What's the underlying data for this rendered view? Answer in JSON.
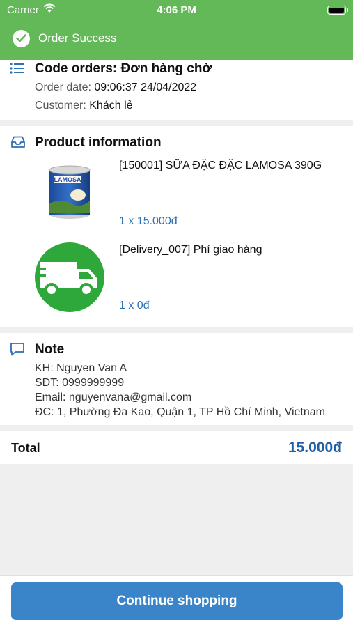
{
  "status_bar": {
    "carrier": "Carrier",
    "time": "4:06 PM"
  },
  "header": {
    "title": "Order Success"
  },
  "order": {
    "code_label": "Code orders: ",
    "code_value": "Đơn hàng chờ",
    "date_label": "Order date: ",
    "date_value": "09:06:37 24/04/2022",
    "customer_label": "Customer: ",
    "customer_value": "Khách lẻ"
  },
  "products": {
    "title": "Product information",
    "items": [
      {
        "name": "[150001] SỮA ĐẶC ĐẶC LAMOSA 390G",
        "qty": "1 x 15.000đ",
        "image": "lamosa-milk-can",
        "label_text": "LAMOSA"
      },
      {
        "name": "[Delivery_007] Phí giao hàng",
        "qty": "1 x 0đ",
        "image": "delivery-truck-icon"
      }
    ]
  },
  "note": {
    "title": "Note",
    "lines": [
      "KH: Nguyen Van A",
      "SĐT: 0999999999",
      "Email: nguyenvana@gmail.com",
      "ĐC: 1, Phường Đa Kao, Quận 1, TP Hồ Chí Minh, Vietnam"
    ]
  },
  "total": {
    "label": "Total",
    "value": "15.000đ"
  },
  "actions": {
    "continue_label": "Continue shopping"
  },
  "colors": {
    "header": "#63b857",
    "accent": "#3a85c9",
    "price": "#1f5ea8",
    "truck": "#2ea83a"
  }
}
